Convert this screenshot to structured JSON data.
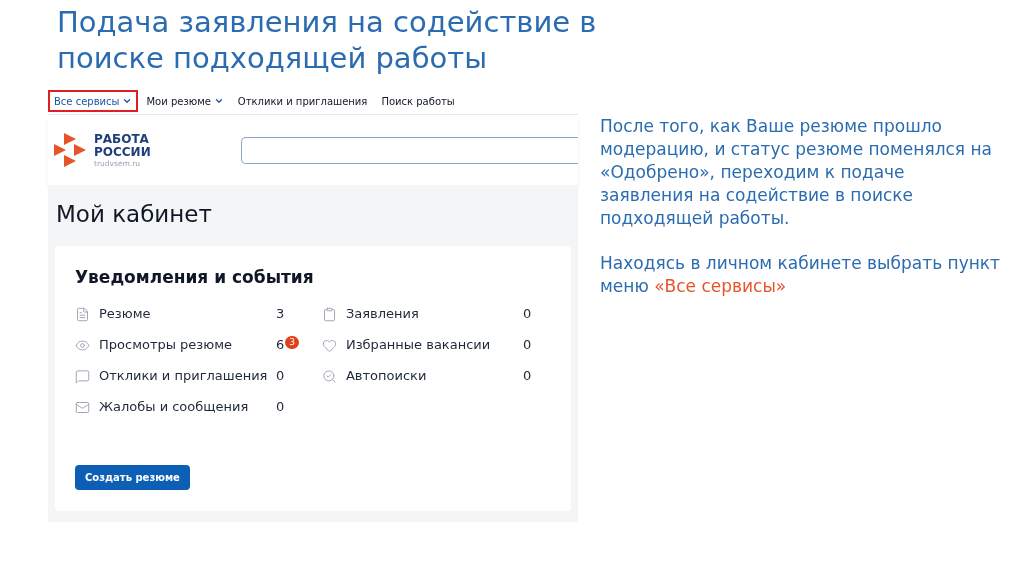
{
  "slide_title": "Подача заявления на содействие в поиске подходящей работы",
  "nav": [
    {
      "label": "Все сервисы",
      "dropdown": true,
      "selected": true
    },
    {
      "label": "Мои резюме",
      "dropdown": true,
      "selected": false
    },
    {
      "label": "Отклики и приглашения",
      "dropdown": false,
      "selected": false
    },
    {
      "label": "Поиск работы",
      "dropdown": false,
      "selected": false
    }
  ],
  "logo": {
    "line1": "РАБОТА",
    "line2": "РОССИИ",
    "site": "trudvsem.ru"
  },
  "page_heading": "Мой кабинет",
  "card": {
    "title": "Уведомления и события",
    "columns": [
      [
        {
          "kind": "document",
          "label": "Резюме",
          "count": "3"
        },
        {
          "kind": "views",
          "label": "Просмотры резюме",
          "count": "6",
          "badge": "3"
        },
        {
          "kind": "responses",
          "label": "Отклики и приглашения",
          "count": "0"
        },
        {
          "kind": "messages",
          "label": "Жалобы и сообщения",
          "count": "0"
        }
      ],
      [
        {
          "kind": "applications",
          "label": "Заявления",
          "count": "0"
        },
        {
          "kind": "favorites",
          "label": "Избранные вакансии",
          "count": "0"
        },
        {
          "kind": "autosearch",
          "label": "Автопоиски",
          "count": "0"
        }
      ]
    ],
    "button": "Создать резюме"
  },
  "explanation": [
    {
      "parts": [
        {
          "kind": "plain",
          "text": "После того, как Ваше резюме прошло модерацию,  и статус резюме поменялся на «Одобрено», переходим к подаче заявления на содействие в поиске подходящей работы."
        }
      ]
    },
    {
      "parts": [
        {
          "kind": "plain",
          "text": "Находясь в личном кабинете выбрать пункт меню "
        },
        {
          "kind": "accent",
          "text": "«Все сервисы»"
        }
      ]
    }
  ]
}
